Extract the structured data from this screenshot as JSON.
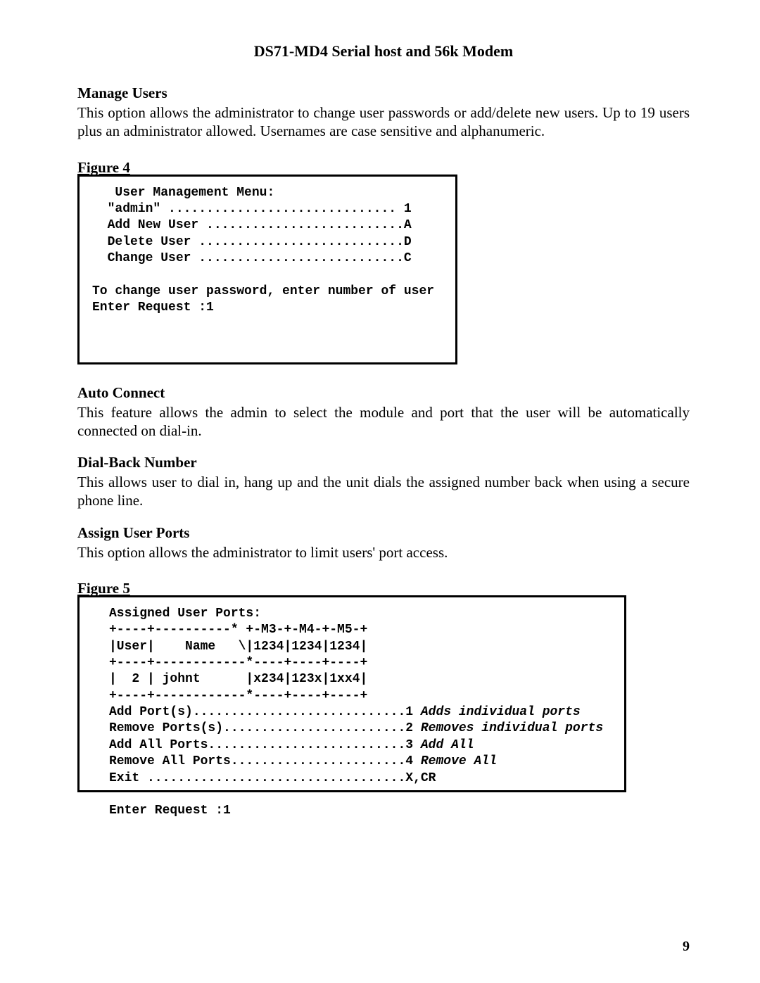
{
  "title": "DS71-MD4 Serial host and 56k Modem",
  "sections": {
    "manageUsers": {
      "heading": "Manage Users",
      "body": "This option allows the administrator to change user passwords or add/delete new users. Up to 19 users plus an administrator allowed. Usernames are case sensitive and alphanumeric."
    },
    "autoConnect": {
      "heading": "Auto Connect",
      "body": "This feature allows the admin to select the module and port that the user will be automatically connected on dial-in."
    },
    "dialBack": {
      "heading": "Dial-Back Number",
      "body": "This allows user to dial in, hang up and the unit dials the assigned number back when using a secure phone line."
    },
    "assignPorts": {
      "heading": "Assign User Ports",
      "body": "This option allows the administrator to limit users' port access."
    }
  },
  "figure4": {
    "label": "Figure 4",
    "terminal": {
      "l1": "   User Management Menu:",
      "l2": "  \"admin\" .............................. 1",
      "l3": "  Add New User ..........................A",
      "l4": "  Delete User ...........................D",
      "l5": "  Change User ...........................C",
      "l6": "",
      "l7": "To change user password, enter number of user",
      "l8": "Enter Request :1"
    }
  },
  "figure5": {
    "label": "Figure 5",
    "terminal": {
      "l1": "Assigned User Ports:",
      "l2": "+----+----------* +-M3-+-M4-+-M5-+",
      "l3": "|User|    Name   \\|1234|1234|1234|",
      "l4": "+----+------------*----+----+----+",
      "l5": "|  2 | johnt      |x234|123x|1xx4|",
      "l6": "+----+------------*----+----+----+",
      "l7a": "Add Port(s)............................1 ",
      "l7b": "Adds individual ports",
      "l8a": "Remove Ports(s)........................2 ",
      "l8b": "Removes individual ports",
      "l9a": "Add All Ports..........................3 ",
      "l9b": "Add All",
      "l10a": "Remove All Ports.......................4 ",
      "l10b": "Remove All",
      "l11": "Exit ..................................X,CR",
      "l12": "",
      "l13": "Enter Request :1"
    }
  },
  "pageNumber": "9"
}
